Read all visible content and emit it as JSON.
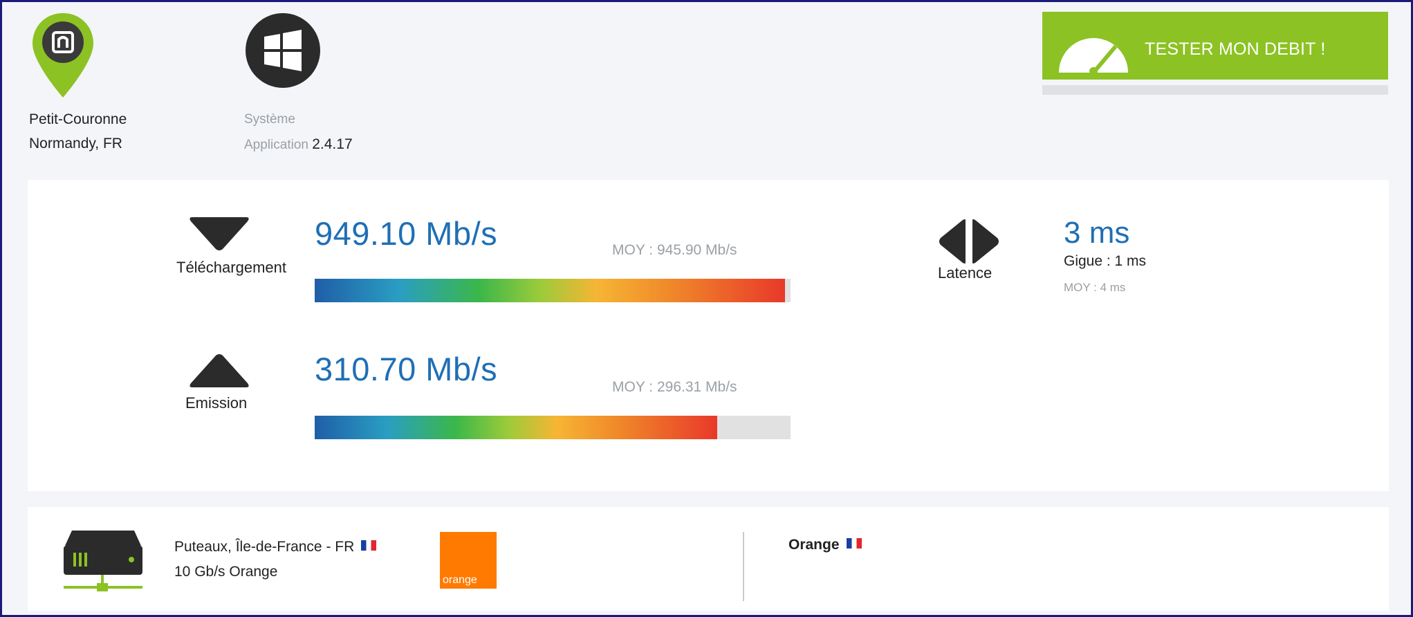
{
  "location": {
    "city": "Petit-Couronne",
    "region": "Normandy, FR",
    "icon": "location-pin-icon",
    "color": "#8cc224"
  },
  "system": {
    "os_icon": "windows-icon",
    "system_label": "Système",
    "app_label": "Application",
    "app_version": "2.4.17"
  },
  "test_button": {
    "label": "TESTER MON DEBIT !",
    "icon": "speedometer-icon",
    "color": "#8cc224"
  },
  "download": {
    "label": "Téléchargement",
    "speed": "949.10 Mb/s",
    "average": "MOY : 945.90 Mb/s",
    "fill_fraction": 0.988
  },
  "upload": {
    "label": "Emission",
    "speed": "310.70 Mb/s",
    "average": "MOY : 296.31 Mb/s",
    "fill_fraction": 0.846
  },
  "latency": {
    "label": "Latence",
    "value": "3 ms",
    "jitter": "Gigue : 1 ms",
    "average": "MOY : 4 ms"
  },
  "server": {
    "icon": "server-icon",
    "location": "Puteaux, Île-de-France - FR",
    "capacity": "10 Gb/s Orange",
    "logo_text": "orange",
    "isp": "Orange"
  },
  "colors": {
    "accent_blue": "#1f6fb5",
    "green": "#8cc224",
    "orange": "#ff7a00"
  }
}
